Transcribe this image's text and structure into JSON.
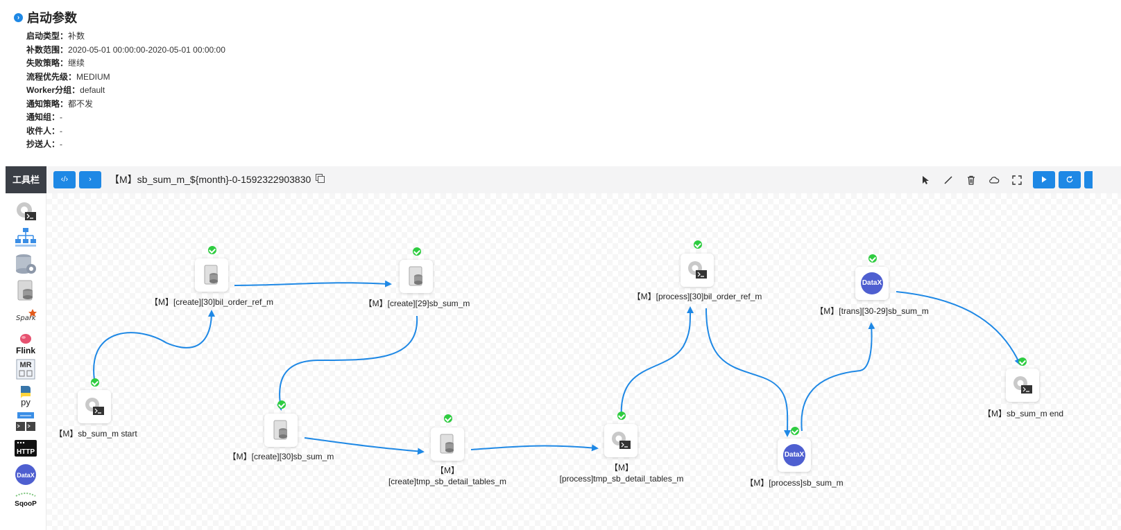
{
  "params": {
    "title": "启动参数",
    "items": [
      {
        "key": "启动类型：",
        "value": "补数"
      },
      {
        "key": "补数范围：",
        "value": "2020-05-01 00:00:00-2020-05-01 00:00:00"
      },
      {
        "key": "失败策略：",
        "value": "继续"
      },
      {
        "key": "流程优先级：",
        "value": "MEDIUM"
      },
      {
        "key": "Worker分组：",
        "value": "default"
      },
      {
        "key": "通知策略：",
        "value": "都不发"
      },
      {
        "key": "通知组：",
        "value": "-"
      },
      {
        "key": "收件人：",
        "value": "-"
      },
      {
        "key": "抄送人：",
        "value": "-"
      }
    ]
  },
  "toolbar": {
    "label": "工具栏",
    "code_button": "‹/›",
    "view_button": "›",
    "title": "【M】sb_sum_m_${month}-0-1592322903830"
  },
  "sidebar": {
    "tools": [
      "shell-icon",
      "sub-process-icon",
      "procedure-icon",
      "sql-icon",
      "spark-icon",
      "flink-icon",
      "mr-icon",
      "python-icon",
      "dependent-icon",
      "http-icon",
      "datax-icon",
      "sqoop-icon"
    ],
    "flink_label": "Flink",
    "mr_label": "MR",
    "python_label": "py",
    "http_label": "HTTP",
    "datax_label": "DataX",
    "sqoop_label": "SqooP",
    "spark_label": "Spark"
  },
  "nodes": {
    "start": "【M】sb_sum_m start",
    "create_bil": "【M】[create][30]bil_order_ref_m",
    "create_29": "【M】[create][29]sb_sum_m",
    "create_30": "【M】[create][30]sb_sum_m",
    "create_tmp": "【M】[create]tmp_sb_detail_tables_m",
    "process_tmp": "【M】[process]tmp_sb_detail_tables_m",
    "process_bil": "【M】[process][30]bil_order_ref_m",
    "process_sb": "【M】[process]sb_sum_m",
    "trans": "【M】[trans][30-29]sb_sum_m",
    "end": "【M】sb_sum_m end",
    "datax_label": "DataX"
  },
  "colors": {
    "accent": "#1e88e5",
    "success": "#2ecc40",
    "datax": "#4e5fd0"
  }
}
